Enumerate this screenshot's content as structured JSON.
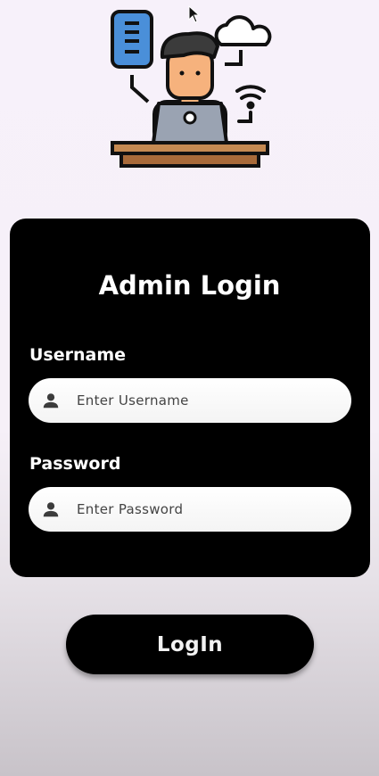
{
  "login_card": {
    "title": "Admin Login",
    "username": {
      "label": "Username",
      "placeholder": "Enter Username",
      "icon": "person-icon"
    },
    "password": {
      "label": "Password",
      "placeholder": "Enter Password",
      "icon": "person-icon"
    }
  },
  "login_button": {
    "label": "LogIn"
  },
  "colors": {
    "card_background": "#000000",
    "page_background": "#f7f1fa",
    "input_background": "#ffffff",
    "button_text": "#f2f2f2"
  }
}
